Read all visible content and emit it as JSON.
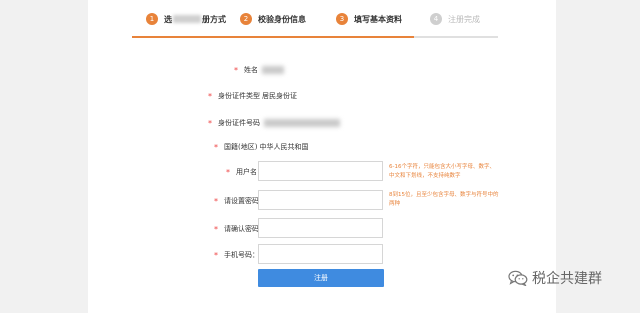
{
  "steps": [
    {
      "number": "1",
      "label_prefix": "选",
      "label_suffix": "册方式",
      "active": true
    },
    {
      "number": "2",
      "label": "校验身份信息",
      "active": true
    },
    {
      "number": "3",
      "label": "填写基本资料",
      "active": true
    },
    {
      "number": "4",
      "label": "注册完成",
      "active": false
    }
  ],
  "form": {
    "name_label": "姓名",
    "id_type_label": "身份证件类型",
    "id_type_value": "居民身份证",
    "id_number_label": "身份证件号码",
    "nationality_label": "国籍(地区)",
    "nationality_value": "中华人民共和国",
    "username_label": "用户名",
    "username_hint": "6-16个字符，只能包含大小写字母、数字、中文和下划线，不支持纯数字",
    "password_label": "请设置密码",
    "password_hint": "8到15位，且至少包含字母、数字与符号中的两种",
    "confirm_label": "请确认密码",
    "phone_label": "手机号码：",
    "submit_label": "注册"
  },
  "watermark": {
    "text": "税企共建群",
    "icon": "wechat-icon"
  },
  "colors": {
    "accent": "#e8833a",
    "primary": "#3f8be0",
    "required": "#e44444"
  }
}
